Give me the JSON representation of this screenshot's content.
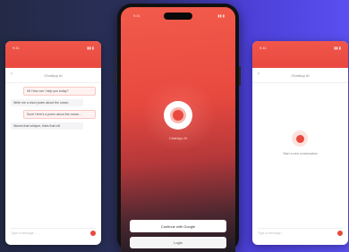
{
  "left_screen": {
    "time": "9:41",
    "status_icons": "▮▮ ▮",
    "title": "ChatApp AI",
    "back_icon": "back-arrow-icon",
    "messages": [
      "Hi! How can I help you today?",
      "Write me a short poem about the ocean",
      "Sure! Here's a poem about the ocean...",
      "Waves that whisper, tides that roll"
    ],
    "input_placeholder": "Type a message..."
  },
  "center_screen": {
    "time": "9:41",
    "status_icons": "▮▮ ▮",
    "app_name": "ChatApp AI",
    "primary_button": "Continue with Google",
    "secondary_button": "Login"
  },
  "right_screen": {
    "time": "9:41",
    "status_icons": "▮▮ ▮",
    "title": "ChatApp AI",
    "back_icon": "back-arrow-icon",
    "empty_text": "Start a new conversation",
    "input_placeholder": "Type a message..."
  },
  "colors": {
    "brand_red": "#e9493f",
    "bg_dark": "#232a45",
    "bg_purple": "#5a4ff0"
  }
}
